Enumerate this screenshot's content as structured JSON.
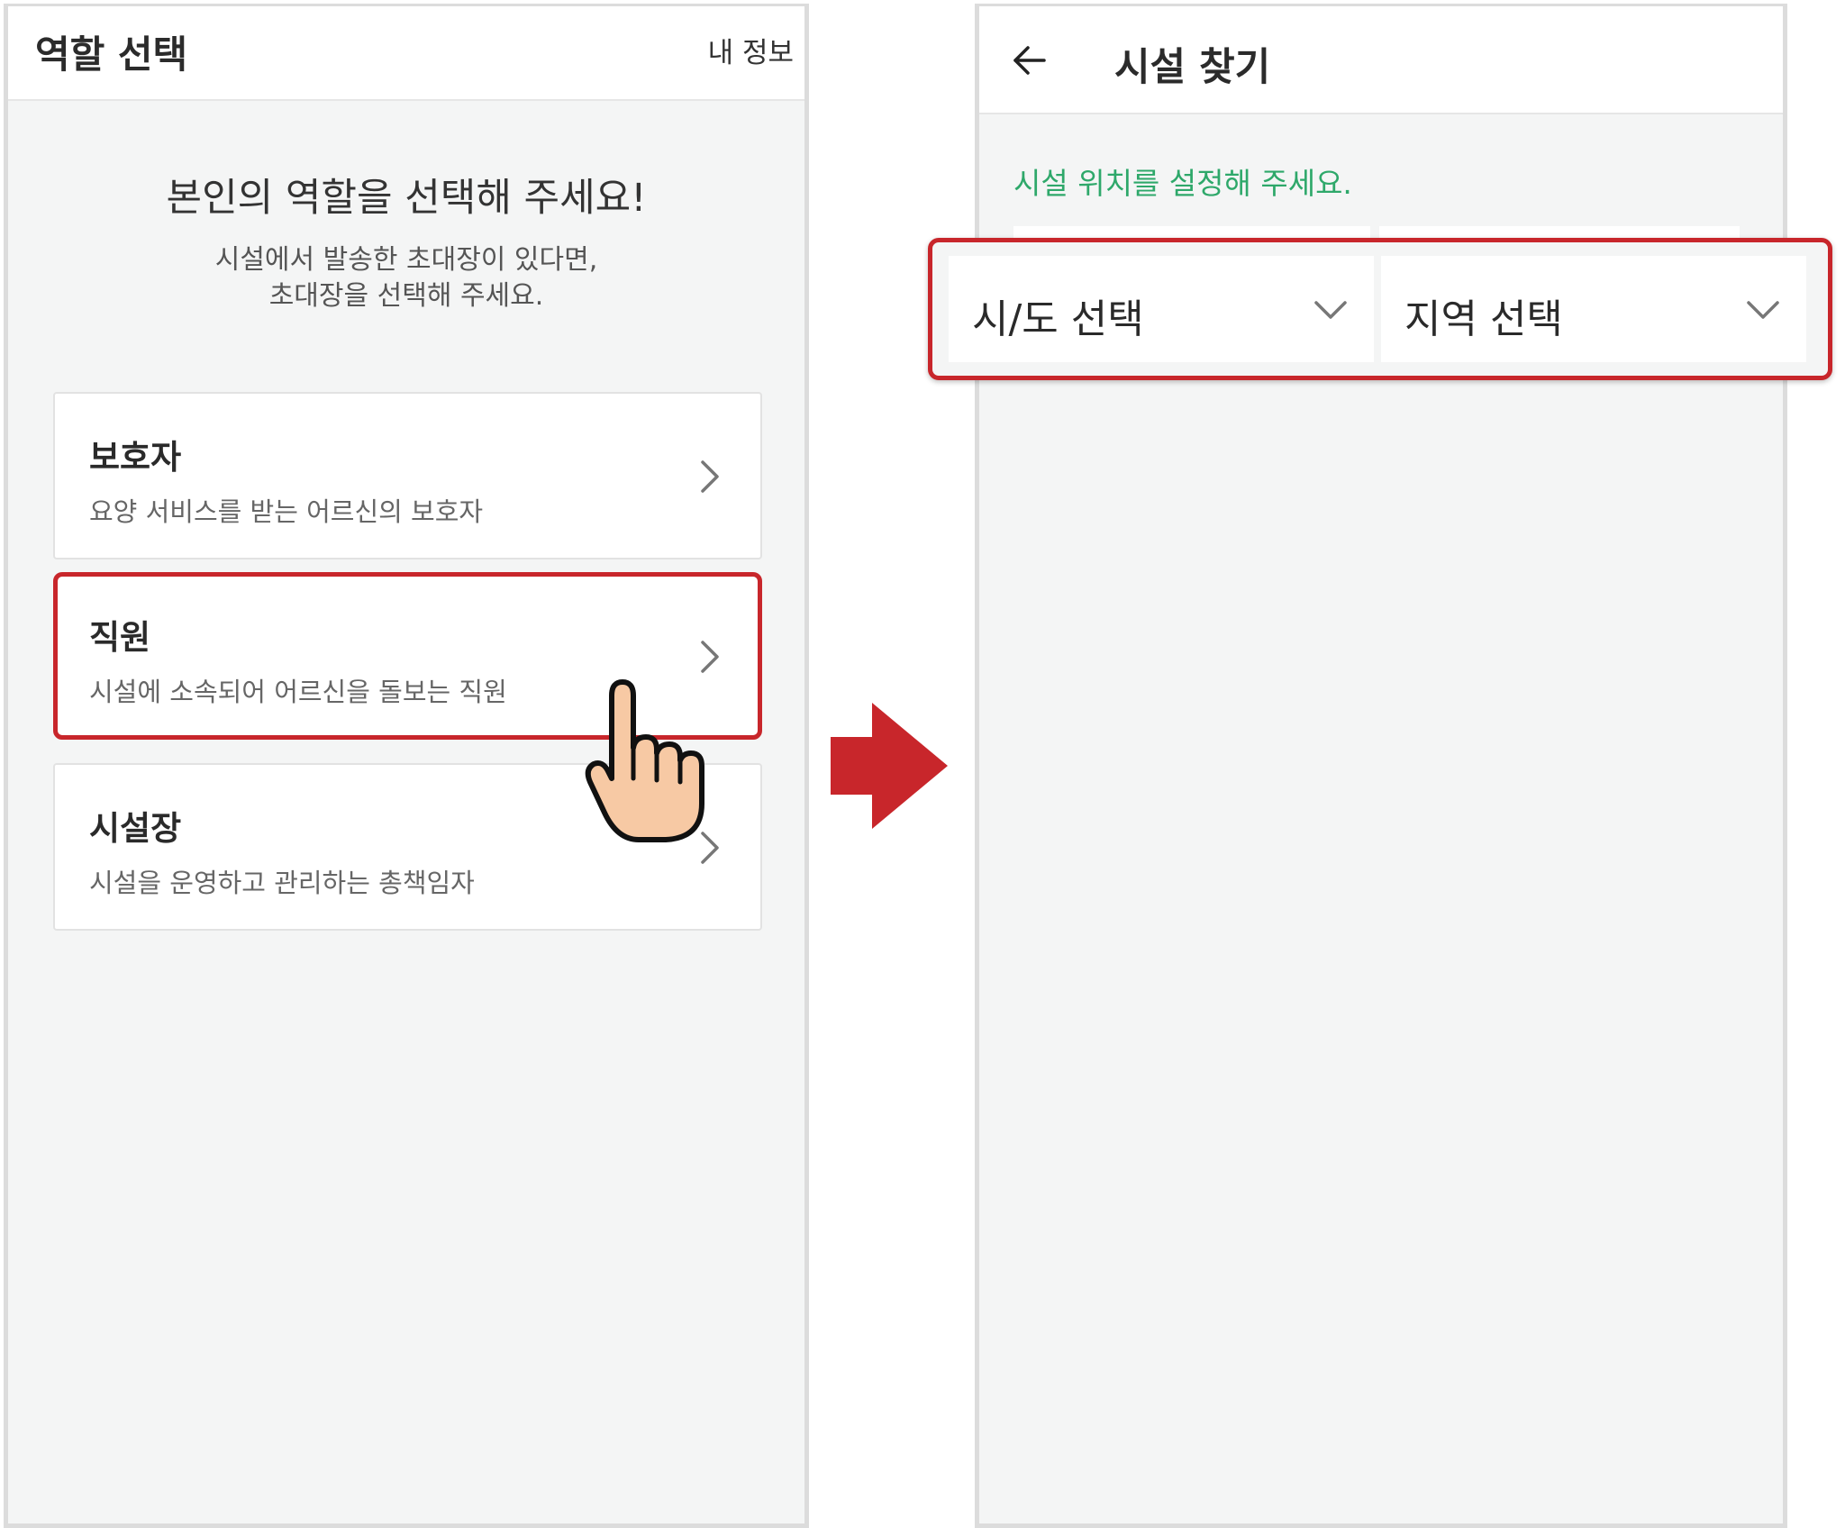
{
  "left_screen": {
    "header": {
      "title": "역할 선택",
      "action": "내 정보"
    },
    "headline": "본인의 역할을 선택해 주세요!",
    "subtext": {
      "line1": "시설에서 발송한 초대장이 있다면,",
      "line2": "초대장을 선택해 주세요."
    },
    "roles": [
      {
        "title": "보호자",
        "description": "요양 서비스를 받는 어르신의 보호자",
        "highlighted": false
      },
      {
        "title": "직원",
        "description": "시설에 소속되어 어르신을 돌보는 직원",
        "highlighted": true
      },
      {
        "title": "시설장",
        "description": "시설을 운영하고 관리하는 총책임자",
        "highlighted": false
      }
    ]
  },
  "right_screen": {
    "header": {
      "back_icon": "arrow-left-icon",
      "title": "시설 찾기"
    },
    "hint": "시설 위치를 설정해 주세요.",
    "selects": [
      {
        "label": "시/도 선택",
        "icon": "chevron-down-icon"
      },
      {
        "label": "지역 선택",
        "icon": "chevron-down-icon"
      }
    ]
  },
  "colors": {
    "highlight": "#c8262b",
    "hint_green": "#2ea86a",
    "hand_fill": "#f7c9a4",
    "arrow": "#c8262b"
  }
}
